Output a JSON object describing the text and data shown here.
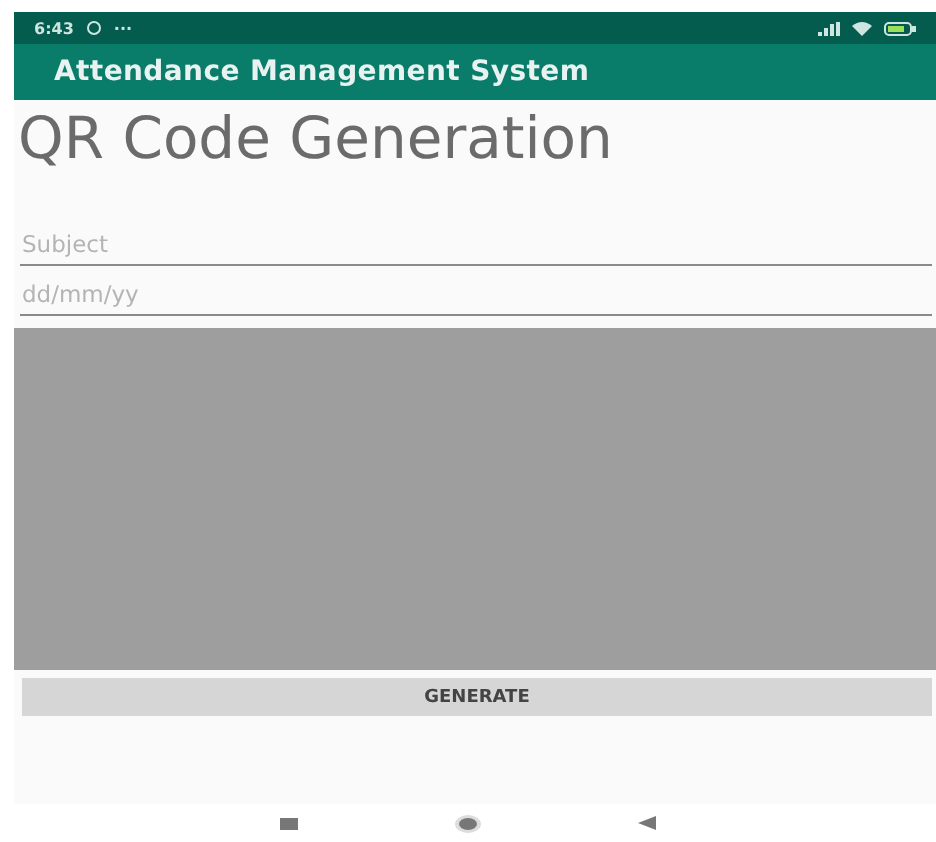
{
  "status_bar": {
    "time": "6:43",
    "more": "···"
  },
  "app_bar": {
    "title": "Attendance Management System"
  },
  "heading": "QR Code Generation",
  "fields": [
    {
      "placeholder": "Subject"
    },
    {
      "placeholder": "dd/mm/yy"
    }
  ],
  "qr_area": {
    "kind": "empty"
  },
  "button": {
    "label": "GENERATE"
  }
}
